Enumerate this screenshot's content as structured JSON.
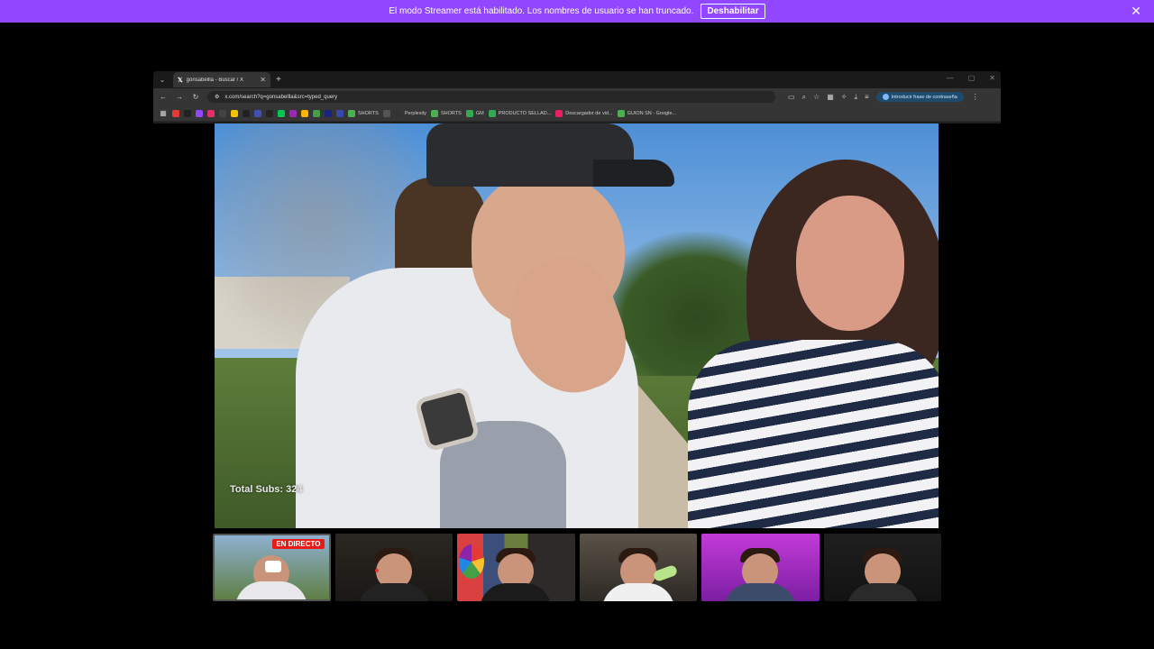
{
  "banner": {
    "message": "El modo Streamer está habilitado. Los nombres de usuario se han truncado.",
    "button_label": "Deshabilitar",
    "close_glyph": "✕",
    "color": "#9147ff"
  },
  "browser": {
    "tab_title": "gonsabellla - Buscar / X",
    "tab_icon": "x-logo",
    "url": "x.com/search?q=gonsabellla&src=typed_query",
    "password_pill": "Introducir frase de contraseña",
    "bookmarks": [
      {
        "label": "",
        "color": "#e53935"
      },
      {
        "label": "",
        "color": "#222222"
      },
      {
        "label": "",
        "color": "#9147ff"
      },
      {
        "label": "",
        "color": "#e1306c"
      },
      {
        "label": "",
        "color": "#444444"
      },
      {
        "label": "",
        "color": "#f2c200"
      },
      {
        "label": "",
        "color": "#222222"
      },
      {
        "label": "",
        "color": "#3f51b5"
      },
      {
        "label": "",
        "color": "#222222"
      },
      {
        "label": "",
        "color": "#00c853"
      },
      {
        "label": "",
        "color": "#9c27b0"
      },
      {
        "label": "",
        "color": "#ffb300"
      },
      {
        "label": "",
        "color": "#43a047"
      },
      {
        "label": "",
        "color": "#1a237e"
      },
      {
        "label": "",
        "color": "#3949ab"
      },
      {
        "label": "SHORTS",
        "color": "#4caf50"
      },
      {
        "label": "",
        "color": "#555555"
      },
      {
        "label": "Perplexity",
        "color": "#333333"
      },
      {
        "label": "SHORTS",
        "color": "#4caf50"
      },
      {
        "label": "GM",
        "color": "#34a853"
      },
      {
        "label": "PRODUCTO SELLAD...",
        "color": "#34a853"
      },
      {
        "label": "Descargador de vid...",
        "color": "#e91e63"
      },
      {
        "label": "GUION SN - Google...",
        "color": "#4caf50"
      }
    ]
  },
  "video": {
    "overlay_text": "Total Subs: 324"
  },
  "thumbnails": [
    {
      "live_label": "EN DIRECTO"
    },
    {},
    {},
    {},
    {},
    {}
  ]
}
